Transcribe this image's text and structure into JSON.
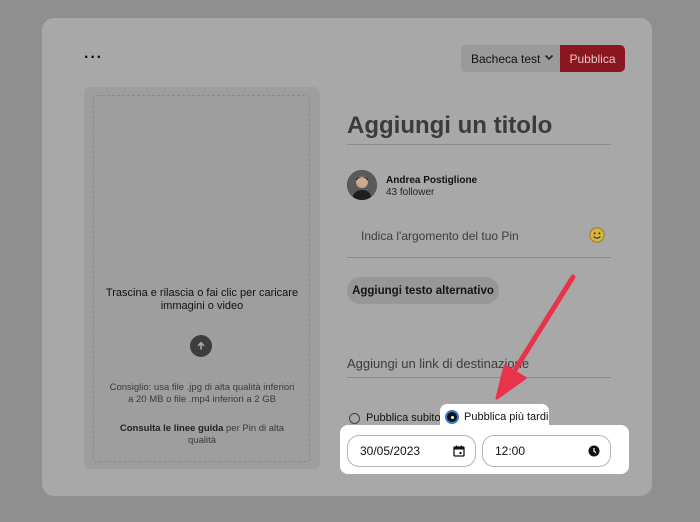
{
  "header": {
    "more_label": "···",
    "board_select": "Bacheca test",
    "publish_button": "Pubblica"
  },
  "upload": {
    "drop_text": "Trascina e rilascia o fai clic per caricare immagini o video",
    "hint": "Consiglio: usa file .jpg di alta qualità inferiori a 20 MB o file .mp4 inferiori a 2 GB",
    "guide_link": "Consulta le linee guida",
    "guide_rest": " per Pin di alta qualità"
  },
  "form": {
    "title_placeholder": "Aggiungi un titolo",
    "user_name": "Andrea Postiglione",
    "user_followers": "43 follower",
    "topic_placeholder": "Indica l'argomento del tuo Pin",
    "alt_text_button": "Aggiungi testo alternativo",
    "link_placeholder": "Aggiungi un link di destinazione",
    "publish_now": "Pubblica subito",
    "publish_later": "Pubblica più tardi",
    "date_value": "30/05/2023",
    "time_value": "12:00"
  },
  "colors": {
    "publish": "#8b1620",
    "arrow": "#e8334a",
    "radio_selected": "#3b7bd6"
  }
}
